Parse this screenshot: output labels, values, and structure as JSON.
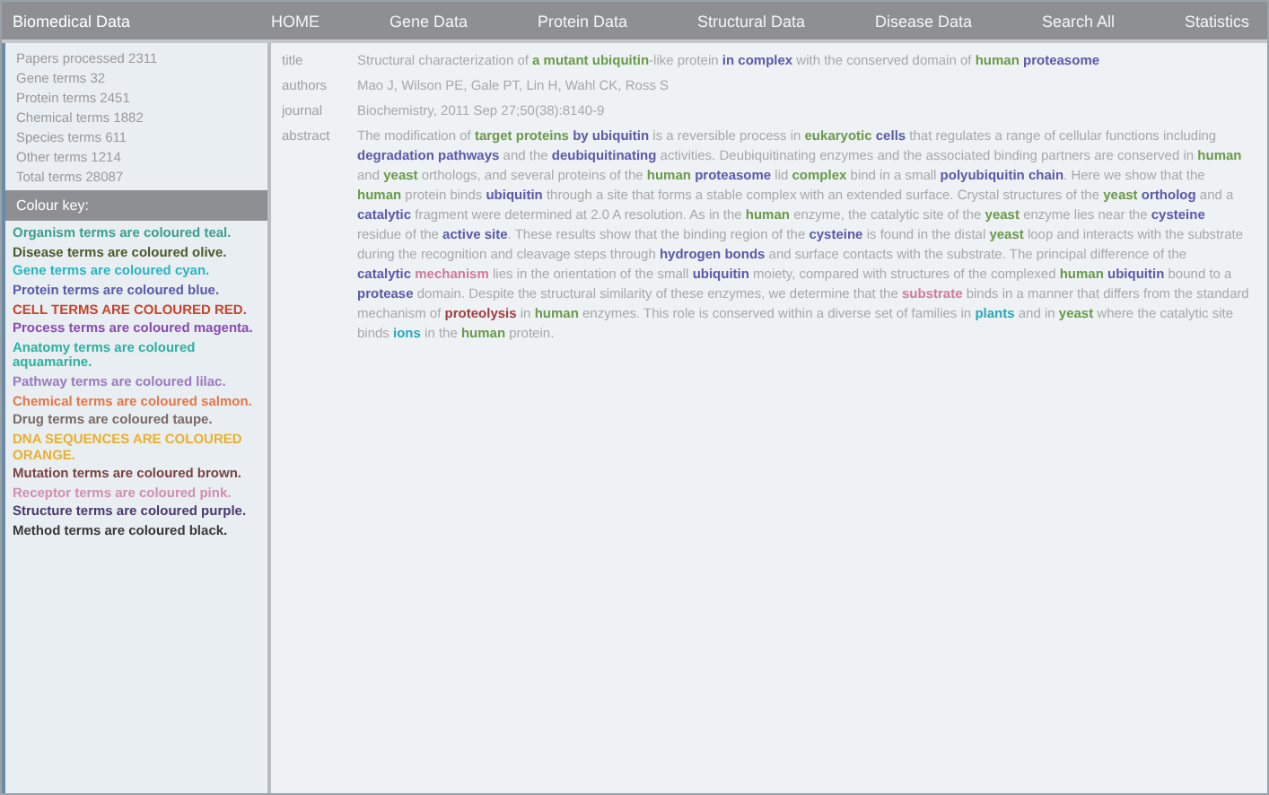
{
  "nav": {
    "brand": "Biomedical Data",
    "links": [
      "HOME",
      "Gene Data",
      "Protein Data",
      "Structural Data",
      "Disease Data",
      "Search All",
      "Statistics"
    ]
  },
  "stats": [
    "Papers processed 2311",
    "Gene terms 32",
    "Protein terms 2451",
    "Chemical terms 1882",
    "Species terms 611",
    "Other terms 1214",
    "Total terms 28087"
  ],
  "legend_title": "Colour key:",
  "legend": [
    {
      "text": "Organism terms are coloured teal.",
      "color": "#3aa08e"
    },
    {
      "text": "Disease terms are coloured olive.",
      "color": "#4d5a2c"
    },
    {
      "text": "Gene terms are coloured cyan.",
      "color": "#2bb5c0"
    },
    {
      "text": "Protein terms are coloured blue.",
      "color": "#5a5aa8"
    },
    {
      "text": "CELL TERMS ARE COLOURED RED.",
      "color": "#c8442e"
    },
    {
      "text": "Process terms are coloured magenta.",
      "color": "#8a4ab0"
    },
    {
      "text": "Anatomy terms are coloured aquamarine.",
      "color": "#2fb0a2"
    },
    {
      "text": "Pathway terms are coloured lilac.",
      "color": "#9a7ac0"
    },
    {
      "text": "Chemical terms are coloured salmon.",
      "color": "#e0784a"
    },
    {
      "text": "Drug terms are coloured taupe.",
      "color": "#7a6a66"
    },
    {
      "text": "DNA SEQUENCES ARE COLOURED ORANGE.",
      "color": "#e8b030"
    },
    {
      "text": "Mutation terms are coloured brown.",
      "color": "#7a4444"
    },
    {
      "text": "Receptor terms are coloured pink.",
      "color": "#d090b0"
    },
    {
      "text": "Structure terms are coloured purple.",
      "color": "#4a3a6a"
    },
    {
      "text": "Method terms are coloured black.",
      "color": "#383838"
    }
  ],
  "fields": [
    {
      "label": "title",
      "segments": [
        {
          "text": "Structural characterization of "
        },
        {
          "text": "a mutant ubiquitin",
          "color": "#6a9a4a"
        },
        {
          "text": "-like protein "
        },
        {
          "text": "in complex",
          "color": "#5a5aa8"
        },
        {
          "text": " with the conserved domain of "
        },
        {
          "text": "human",
          "color": "#6a9a4a"
        },
        {
          "text": "proteasome",
          "color": "#5a5aa8"
        }
      ]
    },
    {
      "label": "authors",
      "segments": [
        {
          "text": "Mao J, Wilson PE, Gale PT, Lin H, Wahl CK, Ross S"
        }
      ]
    },
    {
      "label": "journal",
      "segments": [
        {
          "text": "Biochemistry, 2011 Sep 27;50(38):8140-9"
        }
      ]
    },
    {
      "label": "abstract",
      "segments": [
        {
          "text": "The modification of "
        },
        {
          "text": "target proteins",
          "color": "#6a9a4a"
        },
        {
          "text": "by ubiquitin",
          "color": "#5a5aa8"
        },
        {
          "text": " is a reversible process in "
        },
        {
          "text": "eukaryotic",
          "color": "#6a9a4a"
        },
        {
          "text": "cells",
          "color": "#5a5aa8"
        },
        {
          "text": " that regulates a range of cellular functions including "
        },
        {
          "text": "degradation pathways",
          "color": "#5a5aa8"
        },
        {
          "text": " and the "
        },
        {
          "text": "deubiquitinating",
          "color": "#5a5aa8"
        },
        {
          "text": " activities. Deubiquitinating enzymes and the associated binding partners are conserved in "
        },
        {
          "text": "human",
          "color": "#6a9a4a"
        },
        {
          "text": " and "
        },
        {
          "text": "yeast",
          "color": "#6a9a4a"
        },
        {
          "text": " orthologs, and several proteins of the "
        },
        {
          "text": "human",
          "color": "#6a9a4a"
        },
        {
          "text": "proteasome",
          "color": "#5a5aa8"
        },
        {
          "text": " lid "
        },
        {
          "text": "complex",
          "color": "#6a9a4a"
        },
        {
          "text": " bind in a small "
        },
        {
          "text": "polyubiquitin chain",
          "color": "#5a5aa8"
        },
        {
          "text": ". Here we show that the "
        },
        {
          "text": "human",
          "color": "#6a9a4a"
        },
        {
          "text": " protein binds "
        },
        {
          "text": "ubiquitin",
          "color": "#5a5aa8"
        },
        {
          "text": " through a site that forms a stable complex with an extended surface. Crystal structures of the "
        },
        {
          "text": "yeast",
          "color": "#6a9a4a"
        },
        {
          "text": "ortholog",
          "color": "#5a5aa8"
        },
        {
          "text": " and a "
        },
        {
          "text": "catalytic",
          "color": "#5a5aa8"
        },
        {
          "text": " fragment were determined at 2.0 A resolution. As in the "
        },
        {
          "text": "human",
          "color": "#6a9a4a"
        },
        {
          "text": " enzyme, the catalytic site of the "
        },
        {
          "text": "yeast",
          "color": "#6a9a4a"
        },
        {
          "text": " enzyme lies near the "
        },
        {
          "text": "cysteine",
          "color": "#5a5aa8"
        },
        {
          "text": " residue of the "
        },
        {
          "text": "active site",
          "color": "#5a5aa8"
        },
        {
          "text": ". These results show that the binding region of the "
        },
        {
          "text": "cysteine",
          "color": "#5a5aa8"
        },
        {
          "text": " is found in the distal "
        },
        {
          "text": "yeast",
          "color": "#6a9a4a"
        },
        {
          "text": " loop and interacts with the substrate during the recognition and cleavage steps through "
        },
        {
          "text": "hydrogen bonds",
          "color": "#5a5aa8"
        },
        {
          "text": " and surface contacts with the substrate. The principal difference of the "
        },
        {
          "text": "catalytic",
          "color": "#5a5aa8"
        },
        {
          "text": "mechanism",
          "color": "#d07a9a"
        },
        {
          "text": " lies in the orientation of the small "
        },
        {
          "text": "ubiquitin",
          "color": "#5a5aa8"
        },
        {
          "text": " moiety, compared with structures of the complexed "
        },
        {
          "text": "human",
          "color": "#6a9a4a"
        },
        {
          "text": "ubiquitin",
          "color": "#5a5aa8"
        },
        {
          "text": " bound to a "
        },
        {
          "text": "protease",
          "color": "#5a5aa8"
        },
        {
          "text": " domain. Despite the structural similarity of these enzymes, we determine that the "
        },
        {
          "text": "substrate",
          "color": "#d07a9a"
        },
        {
          "text": " binds in a manner that differs from the standard mechanism of "
        },
        {
          "text": "proteolysis",
          "color": "#a04040"
        },
        {
          "text": " in "
        },
        {
          "text": "human",
          "color": "#6a9a4a"
        },
        {
          "text": " enzymes. This role is conserved within a diverse set of families in "
        },
        {
          "text": "plants",
          "color": "#2ba8b8"
        },
        {
          "text": " and in "
        },
        {
          "text": "yeast",
          "color": "#6a9a4a"
        },
        {
          "text": " where the catalytic site binds "
        },
        {
          "text": "ions",
          "color": "#2ba8b8"
        },
        {
          "text": " in the "
        },
        {
          "text": "human",
          "color": "#6a9a4a"
        },
        {
          "text": " protein."
        }
      ]
    }
  ]
}
